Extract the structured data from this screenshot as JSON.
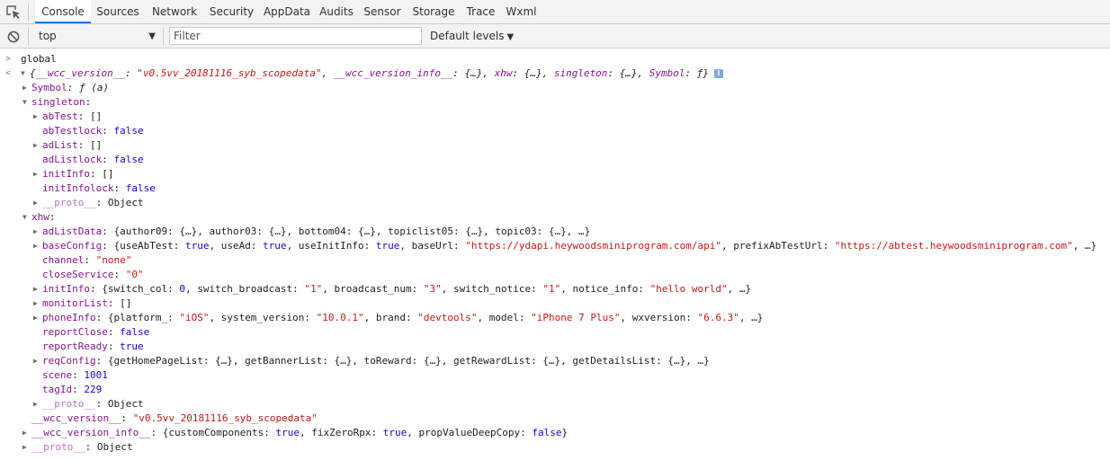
{
  "tabs": [
    {
      "label": "Console",
      "active": true
    },
    {
      "label": "Sources"
    },
    {
      "label": "Network"
    },
    {
      "label": "Security"
    },
    {
      "label": "AppData"
    },
    {
      "label": "Audits"
    },
    {
      "label": "Sensor"
    },
    {
      "label": "Storage"
    },
    {
      "label": "Trace"
    },
    {
      "label": "Wxml"
    }
  ],
  "toolbar": {
    "context": "top",
    "filter_placeholder": "Filter",
    "levels": "Default levels"
  },
  "icons": {
    "inspect": "inspect-element-icon",
    "clear": "clear-console-icon"
  },
  "colors": {
    "accent": "#1a73e8",
    "key": "#881391",
    "string": "#c41a16",
    "number": "#1c00cf"
  },
  "console": {
    "input_prompt": ">",
    "input": "global",
    "result_prompt": "<",
    "root_summary": [
      {
        "t": "{"
      },
      {
        "t": "__wcc_version__",
        "c": "k"
      },
      {
        "t": ": "
      },
      {
        "t": "\"v0.5vv_20181116_syb_scopedata\"",
        "c": "s"
      },
      {
        "t": ", "
      },
      {
        "t": "__wcc_version_info__",
        "c": "k"
      },
      {
        "t": ": {…}, "
      },
      {
        "t": "xhw",
        "c": "k"
      },
      {
        "t": ": {…}, "
      },
      {
        "t": "singleton",
        "c": "k"
      },
      {
        "t": ": {…}, "
      },
      {
        "t": "Symbol",
        "c": "k"
      },
      {
        "t": ": ƒ}"
      }
    ],
    "info_badge": "i",
    "entries": [
      {
        "indent": 1,
        "arrow": "right",
        "parts": [
          {
            "t": "Symbol",
            "c": "k"
          },
          {
            "t": ": ƒ (a)",
            "c": "i"
          }
        ]
      },
      {
        "indent": 1,
        "arrow": "down",
        "parts": [
          {
            "t": "singleton",
            "c": "k"
          },
          {
            "t": ":"
          }
        ]
      },
      {
        "indent": 2,
        "arrow": "right",
        "parts": [
          {
            "t": "abTest",
            "c": "k"
          },
          {
            "t": ": []"
          }
        ]
      },
      {
        "indent": 2,
        "parts": [
          {
            "t": "abTestlock",
            "c": "k"
          },
          {
            "t": ": "
          },
          {
            "t": "false",
            "c": "n"
          }
        ]
      },
      {
        "indent": 2,
        "arrow": "right",
        "parts": [
          {
            "t": "adList",
            "c": "k"
          },
          {
            "t": ": []"
          }
        ]
      },
      {
        "indent": 2,
        "parts": [
          {
            "t": "adListlock",
            "c": "k"
          },
          {
            "t": ": "
          },
          {
            "t": "false",
            "c": "n"
          }
        ]
      },
      {
        "indent": 2,
        "arrow": "right",
        "parts": [
          {
            "t": "initInfo",
            "c": "k"
          },
          {
            "t": ": []"
          }
        ]
      },
      {
        "indent": 2,
        "parts": [
          {
            "t": "initInfolock",
            "c": "k"
          },
          {
            "t": ": "
          },
          {
            "t": "false",
            "c": "n"
          }
        ]
      },
      {
        "indent": 2,
        "arrow": "right",
        "parts": [
          {
            "t": "__proto__",
            "c": "kd"
          },
          {
            "t": ": Object"
          }
        ]
      },
      {
        "indent": 1,
        "arrow": "down",
        "parts": [
          {
            "t": "xhw",
            "c": "k"
          },
          {
            "t": ":"
          }
        ]
      },
      {
        "indent": 2,
        "arrow": "right",
        "parts": [
          {
            "t": "adListData",
            "c": "k"
          },
          {
            "t": ": {author09: {…}, author03: {…}, bottom04: {…}, topiclist05: {…}, topic03: {…}, …}"
          }
        ]
      },
      {
        "indent": 2,
        "arrow": "right",
        "parts": [
          {
            "t": "baseConfig",
            "c": "k"
          },
          {
            "t": ": {useAbTest: "
          },
          {
            "t": "true",
            "c": "n"
          },
          {
            "t": ", useAd: "
          },
          {
            "t": "true",
            "c": "n"
          },
          {
            "t": ", useInitInfo: "
          },
          {
            "t": "true",
            "c": "n"
          },
          {
            "t": ", baseUrl: "
          },
          {
            "t": "\"https://ydapi.heywoodsminiprogram.com/api\"",
            "c": "s"
          },
          {
            "t": ", prefixAbTestUrl: "
          },
          {
            "t": "\"https://abtest.heywoodsminiprogram.com\"",
            "c": "s"
          },
          {
            "t": ", …}"
          }
        ]
      },
      {
        "indent": 2,
        "parts": [
          {
            "t": "channel",
            "c": "k"
          },
          {
            "t": ": "
          },
          {
            "t": "\"none\"",
            "c": "s"
          }
        ]
      },
      {
        "indent": 2,
        "parts": [
          {
            "t": "closeService",
            "c": "k"
          },
          {
            "t": ": "
          },
          {
            "t": "\"0\"",
            "c": "s"
          }
        ]
      },
      {
        "indent": 2,
        "arrow": "right",
        "parts": [
          {
            "t": "initInfo",
            "c": "k"
          },
          {
            "t": ": {switch_col: "
          },
          {
            "t": "0",
            "c": "n"
          },
          {
            "t": ", switch_broadcast: "
          },
          {
            "t": "\"1\"",
            "c": "s"
          },
          {
            "t": ", broadcast_num: "
          },
          {
            "t": "\"3\"",
            "c": "s"
          },
          {
            "t": ", switch_notice: "
          },
          {
            "t": "\"1\"",
            "c": "s"
          },
          {
            "t": ", notice_info: "
          },
          {
            "t": "\"hello world\"",
            "c": "s"
          },
          {
            "t": ", …}"
          }
        ]
      },
      {
        "indent": 2,
        "arrow": "right",
        "parts": [
          {
            "t": "monitorList",
            "c": "k"
          },
          {
            "t": ": []"
          }
        ]
      },
      {
        "indent": 2,
        "arrow": "right",
        "parts": [
          {
            "t": "phoneInfo",
            "c": "k"
          },
          {
            "t": ": {platform_: "
          },
          {
            "t": "\"iOS\"",
            "c": "s"
          },
          {
            "t": ", system_version: "
          },
          {
            "t": "\"10.0.1\"",
            "c": "s"
          },
          {
            "t": ", brand: "
          },
          {
            "t": "\"devtools\"",
            "c": "s"
          },
          {
            "t": ", model: "
          },
          {
            "t": "\"iPhone 7 Plus\"",
            "c": "s"
          },
          {
            "t": ", wxversion: "
          },
          {
            "t": "\"6.6.3\"",
            "c": "s"
          },
          {
            "t": ", …}"
          }
        ]
      },
      {
        "indent": 2,
        "parts": [
          {
            "t": "reportClose",
            "c": "k"
          },
          {
            "t": ": "
          },
          {
            "t": "false",
            "c": "n"
          }
        ]
      },
      {
        "indent": 2,
        "parts": [
          {
            "t": "reportReady",
            "c": "k"
          },
          {
            "t": ": "
          },
          {
            "t": "true",
            "c": "n"
          }
        ]
      },
      {
        "indent": 2,
        "arrow": "right",
        "parts": [
          {
            "t": "reqConfig",
            "c": "k"
          },
          {
            "t": ": {getHomePageList: {…}, getBannerList: {…}, toReward: {…}, getRewardList: {…}, getDetailsList: {…}, …}"
          }
        ]
      },
      {
        "indent": 2,
        "parts": [
          {
            "t": "scene",
            "c": "k"
          },
          {
            "t": ": "
          },
          {
            "t": "1001",
            "c": "n"
          }
        ]
      },
      {
        "indent": 2,
        "parts": [
          {
            "t": "tagId",
            "c": "k"
          },
          {
            "t": ": "
          },
          {
            "t": "229",
            "c": "n"
          }
        ]
      },
      {
        "indent": 2,
        "arrow": "right",
        "parts": [
          {
            "t": "__proto__",
            "c": "kd"
          },
          {
            "t": ": Object"
          }
        ]
      },
      {
        "indent": 1,
        "parts": [
          {
            "t": "__wcc_version__",
            "c": "k"
          },
          {
            "t": ": "
          },
          {
            "t": "\"v0.5vv_20181116_syb_scopedata\"",
            "c": "s"
          }
        ]
      },
      {
        "indent": 1,
        "arrow": "right",
        "parts": [
          {
            "t": "__wcc_version_info__",
            "c": "k"
          },
          {
            "t": ": {customComponents: "
          },
          {
            "t": "true",
            "c": "n"
          },
          {
            "t": ", fixZeroRpx: "
          },
          {
            "t": "true",
            "c": "n"
          },
          {
            "t": ", propValueDeepCopy: "
          },
          {
            "t": "false",
            "c": "n"
          },
          {
            "t": "}"
          }
        ]
      },
      {
        "indent": 1,
        "arrow": "right",
        "parts": [
          {
            "t": "__proto__",
            "c": "kd"
          },
          {
            "t": ": Object"
          }
        ]
      }
    ]
  }
}
